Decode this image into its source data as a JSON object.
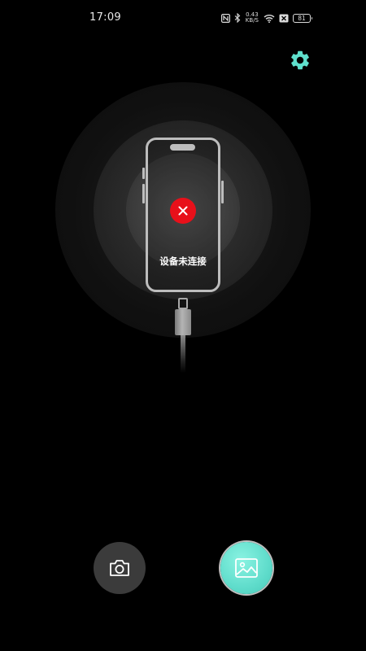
{
  "status_bar": {
    "time": "17:09",
    "net_speed_value": "0.43",
    "net_speed_unit": "KB/S",
    "battery_level": "81",
    "icons": [
      "nfc-icon",
      "bluetooth-icon",
      "wifi-icon",
      "sim-disabled-icon",
      "battery-icon"
    ]
  },
  "settings": {
    "icon": "gear-icon",
    "color": "#5fe0cd"
  },
  "device": {
    "status_text": "设备未连接",
    "status_icon": "close-icon",
    "status_color": "#e8101a"
  },
  "actions": {
    "camera_icon": "camera-icon",
    "gallery_icon": "image-icon",
    "accent_color": "#5fdccb"
  }
}
